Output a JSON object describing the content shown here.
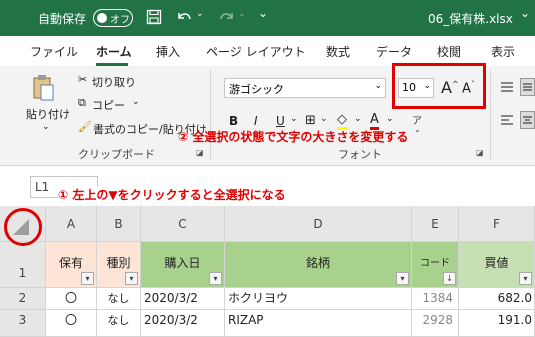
{
  "titlebar": {
    "autosave_label": "自動保存",
    "toggle_label": "オフ",
    "filename": "06_保有株.xlsx",
    "dropdown": "⌄"
  },
  "tabs": [
    "ファイル",
    "ホーム",
    "挿入",
    "ページ レイアウト",
    "数式",
    "データ",
    "校閲",
    "表示"
  ],
  "ribbon": {
    "paste_label": "貼り付け",
    "paste_arrow": "⌄",
    "cut_label": "切り取り",
    "copy_label": "コピー",
    "format_painter_label": "書式のコピー/貼り付け",
    "clipboard_group": "クリップボード",
    "font_name": "游ゴシック",
    "font_size": "10",
    "font_group": "フォント",
    "grow_font": "A",
    "shrink_font": "A",
    "bold": "B",
    "italic": "I",
    "underline": "U",
    "font_color": "A",
    "phonetic": "ア"
  },
  "annotations": {
    "step2": "② 全選択の状態で文字の大きさを変更する",
    "step1": "① 左上の▼をクリックすると全選択になる"
  },
  "formulabar": {
    "namebox": "L1"
  },
  "columns": [
    "A",
    "B",
    "C",
    "D",
    "E",
    "F"
  ],
  "rows": [
    "1",
    "2",
    "3"
  ],
  "header_row": [
    "保有",
    "種別",
    "購入日",
    "銘柄",
    "コード",
    "買値"
  ],
  "data_rows": [
    [
      "〇",
      "なし",
      "2020/3/2",
      "ホクリヨウ",
      "1384",
      "682.0"
    ],
    [
      "〇",
      "なし",
      "2020/3/2",
      "RIZAP",
      "2928",
      "191.0"
    ]
  ],
  "colors": {
    "excel_green": "#217346",
    "highlight_red": "#e00000",
    "header_peach": "#fce4d6",
    "header_green": "#a9d18e",
    "header_green2": "#c6e0b4"
  }
}
